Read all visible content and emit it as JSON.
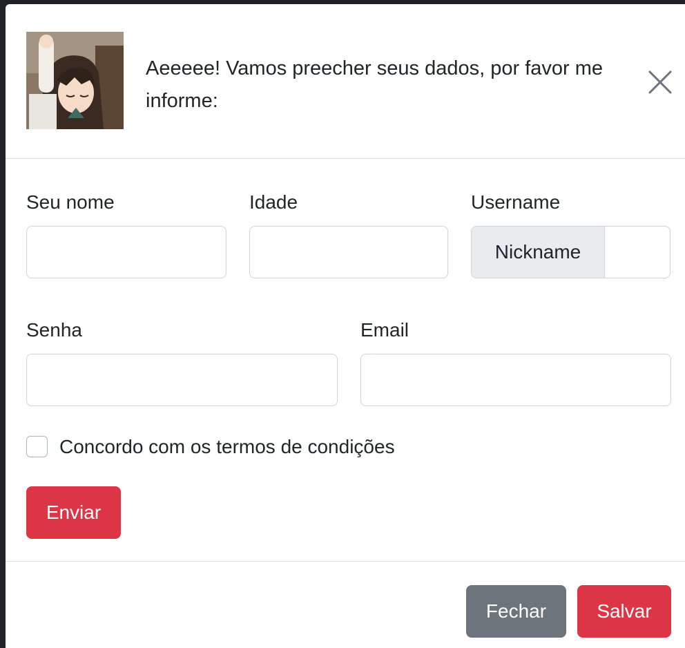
{
  "header": {
    "title": "Aeeeee! Vamos preecher seus dados, por favor me informe:",
    "avatar_icon": "anime-avatar-image",
    "close_icon": "close-icon"
  },
  "form": {
    "name_label": "Seu nome",
    "age_label": "Idade",
    "username_label": "Username",
    "username_prefix": "Nickname",
    "password_label": "Senha",
    "email_label": "Email",
    "terms_label": "Concordo com os termos de condições",
    "submit_label": "Enviar"
  },
  "footer": {
    "close_label": "Fechar",
    "save_label": "Salvar"
  },
  "colors": {
    "danger": "#dc3545",
    "secondary": "#6c757d",
    "input_group_bg": "#e9ecef",
    "border": "#ced4da"
  }
}
